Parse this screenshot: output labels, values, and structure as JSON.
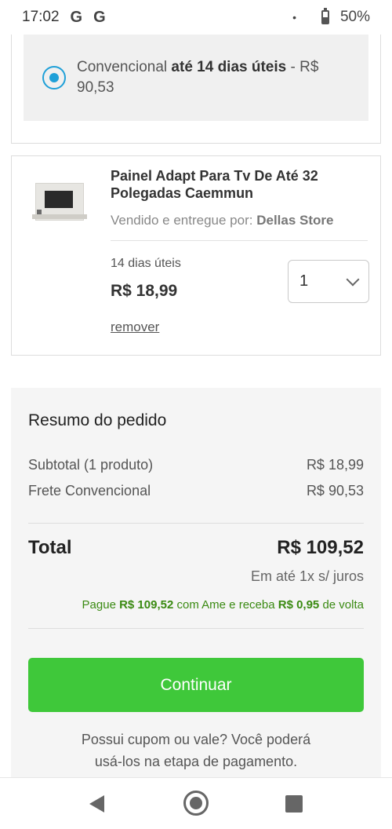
{
  "status_bar": {
    "time": "17:02",
    "notif_icons": [
      "G",
      "G"
    ],
    "dot": "•",
    "battery": "50%"
  },
  "shipping": {
    "option_name": "Convencional",
    "option_days": "até 14 dias úteis",
    "option_price_prefix": "- R$",
    "option_price": "90,53",
    "selected": true
  },
  "product": {
    "title": "Painel Adapt Para Tv De Até 32 Polegadas Caemmun",
    "seller_prefix": "Vendido e entregue por:",
    "seller": "Dellas Store",
    "delivery_days": "14 dias úteis",
    "price": "R$ 18,99",
    "quantity": "1",
    "remove_label": "remover"
  },
  "summary": {
    "title": "Resumo do pedido",
    "subtotal_label": "Subtotal (1 produto)",
    "subtotal_value": "R$ 18,99",
    "shipping_label": "Frete Convencional",
    "shipping_value": "R$ 90,53",
    "total_label": "Total",
    "total_value": "R$ 109,52",
    "installments": "Em até 1x s/ juros",
    "ame_pay": "Pague",
    "ame_amount": "R$ 109,52",
    "ame_mid": "com Ame e receba",
    "ame_cashback": "R$ 0,95",
    "ame_end": "de volta",
    "continue_label": "Continuar",
    "coupon_line1": "Possui cupom ou vale? Você poderá",
    "coupon_line2": "usá-los na etapa de pagamento."
  },
  "colors": {
    "accent_blue": "#1fa0d8",
    "continue_green": "#3fc83a",
    "ame_green": "#3a8a12"
  }
}
